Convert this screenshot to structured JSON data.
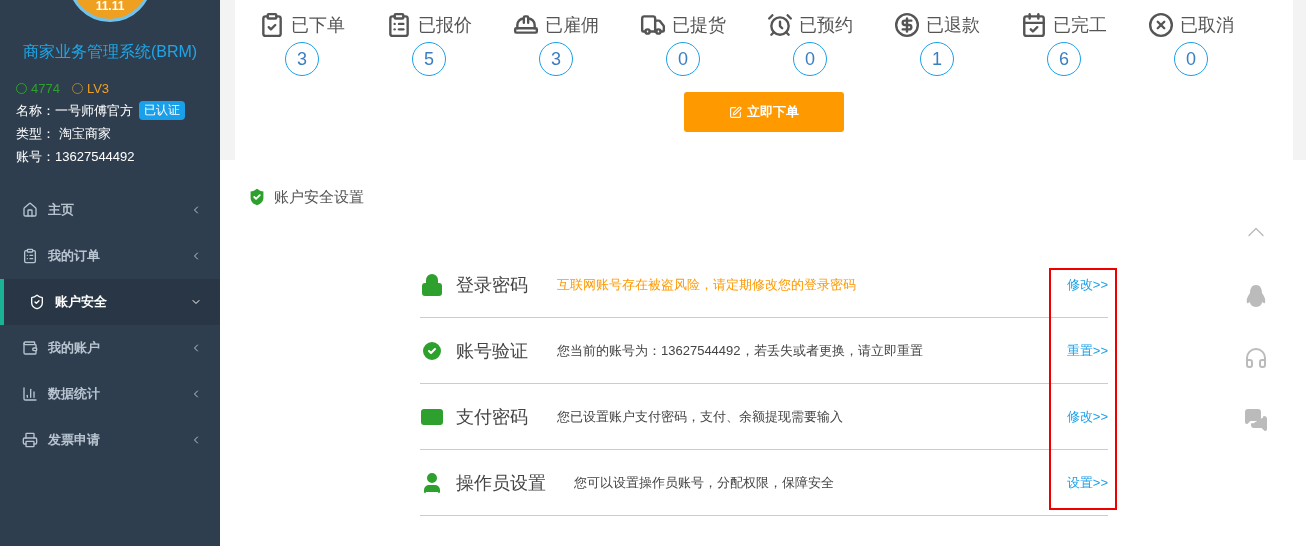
{
  "sidebar": {
    "badge": "11.11",
    "title": "商家业务管理系统(BRM)",
    "points": "4774",
    "level": "LV3",
    "info": [
      {
        "text": "名称：一号师傅官方",
        "tag": "已认证"
      },
      {
        "text": "类型： 淘宝商家"
      },
      {
        "text": "账号：13627544492"
      }
    ],
    "menu": [
      {
        "label": "主页",
        "selected": false,
        "expanded": false
      },
      {
        "label": "我的订单",
        "selected": false,
        "expanded": false
      },
      {
        "label": "账户安全",
        "selected": true,
        "expanded": true
      },
      {
        "label": "我的账户",
        "selected": false,
        "expanded": false
      },
      {
        "label": "数据统计",
        "selected": false,
        "expanded": false
      },
      {
        "label": "发票申请",
        "selected": false,
        "expanded": false
      }
    ]
  },
  "stats": [
    {
      "label": "已下单",
      "count": "3"
    },
    {
      "label": "已报价",
      "count": "5"
    },
    {
      "label": "已雇佣",
      "count": "3"
    },
    {
      "label": "已提货",
      "count": "0"
    },
    {
      "label": "已预约",
      "count": "0"
    },
    {
      "label": "已退款",
      "count": "1"
    },
    {
      "label": "已完工",
      "count": "6"
    },
    {
      "label": "已取消",
      "count": "0"
    }
  ],
  "order_button": "立即下单",
  "security": {
    "title": "账户安全设置",
    "links_highlighted": true,
    "rows": [
      {
        "title": "登录密码",
        "description": "互联网账号存在被盗风险，请定期修改您的登录密码",
        "warning": true,
        "link": "修改>>"
      },
      {
        "title": "账号验证",
        "description": "您当前的账号为：13627544492，若丢失或者更换，请立即重置",
        "warning": false,
        "link": "重置>>"
      },
      {
        "title": "支付密码",
        "description": "您已设置账户支付密码，支付、余额提现需要输入",
        "warning": false,
        "link": "修改>>"
      },
      {
        "title": "操作员设置",
        "description": "您可以设置操作员账号，分配权限，保障安全",
        "warning": false,
        "link": "设置>>"
      }
    ]
  }
}
